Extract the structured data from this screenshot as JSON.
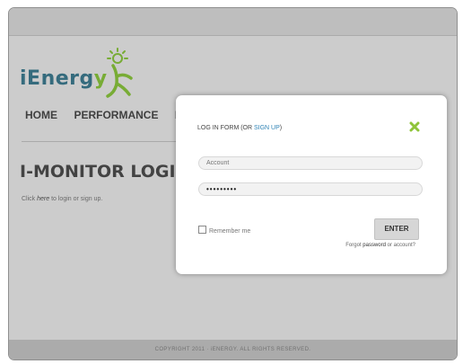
{
  "logo": {
    "text_main": "iEnerg",
    "text_accent": "y"
  },
  "nav": {
    "items": [
      "HOME",
      "PERFORMANCE",
      "F"
    ]
  },
  "page": {
    "title": "I-MONITOR LOGIN",
    "hint_prefix": "Click ",
    "hint_here": "here",
    "hint_suffix": " to login or sign up."
  },
  "modal": {
    "header_prefix": "LOG IN FORM (OR ",
    "header_signup": "SIGN UP",
    "header_suffix": ")",
    "account_placeholder": "Account",
    "password_value": "•••••••••",
    "remember_label": "Remember me",
    "enter_label": "ENTER",
    "forgot_prefix": "Forgot ",
    "forgot_link": "password",
    "forgot_suffix": " or account?"
  },
  "footer": {
    "text": "COPYRIGHT 2011 · iENERGY. ALL RIGHTS RESERVED."
  },
  "colors": {
    "brand_blue": "#2e6f86",
    "brand_green": "#7fbf2e",
    "link_blue": "#2f83b5",
    "close_green": "#8fc43a"
  }
}
